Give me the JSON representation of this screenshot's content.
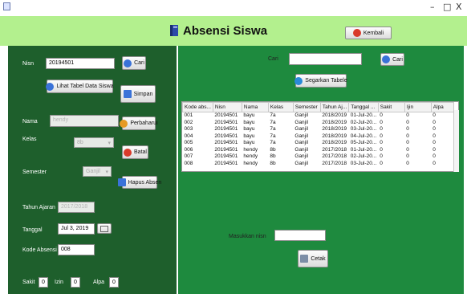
{
  "window": {
    "minimize": "–",
    "maximize": "□",
    "close": "X"
  },
  "header": {
    "title": "Absensi Siswa",
    "back_button": "Kembali"
  },
  "form": {
    "nisn_label": "Nisn",
    "nisn_value": "20194501",
    "search_button": "Cari",
    "view_table_button": "Lihat Tabel Data Siswa",
    "save_button": "Simpan",
    "nama_label": "Nama",
    "nama_value": "hendy",
    "update_button": "Perbaharui",
    "kelas_label": "Kelas",
    "kelas_value": "8b",
    "cancel_button": "Batal",
    "semester_label": "Semester",
    "semester_value": "Ganjil",
    "delete_button": "Hapus Absen",
    "tahun_label": "Tahun Ajaran",
    "tahun_value": "2017/2018",
    "tanggal_label": "Tanggal",
    "tanggal_value": "Jul 3, 2019",
    "kode_label": "Kode Absensi",
    "kode_value": "008",
    "sakit_label": "Sakit",
    "sakit_value": "0",
    "izin_label": "Izin",
    "izin_value": "0",
    "alpa_label": "Alpa",
    "alpa_value": "0"
  },
  "right": {
    "cari_label": "Cari",
    "cari_value": "",
    "cari_button": "Cari",
    "refresh_button": "Segarkan Tabele",
    "masukkan_label": "Masukkan nisn",
    "masukkan_value": "",
    "print_button": "Cetak"
  },
  "table": {
    "columns": [
      "Kode abs...",
      "Nisn",
      "Nama",
      "Kelas",
      "Semester",
      "Tahun Aj...",
      "Tanggal ...",
      "Sakit",
      "Ijin",
      "Alpa"
    ],
    "rows": [
      [
        "001",
        "20194501",
        "bayu",
        "7a",
        "Ganjil",
        "2018/2019",
        "01-Jul-20...",
        "0",
        "0",
        "0"
      ],
      [
        "002",
        "20194501",
        "bayu",
        "7a",
        "Ganjil",
        "2018/2019",
        "02-Jul-20...",
        "0",
        "0",
        "0"
      ],
      [
        "003",
        "20194501",
        "bayu",
        "7a",
        "Ganjil",
        "2018/2019",
        "03-Jul-20...",
        "0",
        "0",
        "0"
      ],
      [
        "004",
        "20194501",
        "bayu",
        "7a",
        "Ganjil",
        "2018/2019",
        "04-Jul-20...",
        "0",
        "0",
        "0"
      ],
      [
        "005",
        "20194501",
        "bayu",
        "7a",
        "Ganjil",
        "2018/2019",
        "05-Jul-20...",
        "0",
        "0",
        "0"
      ],
      [
        "006",
        "20194501",
        "hendy",
        "8b",
        "Ganjil",
        "2017/2018",
        "01-Jul-20...",
        "0",
        "0",
        "0"
      ],
      [
        "007",
        "20194501",
        "hendy",
        "8b",
        "Ganjil",
        "2017/2018",
        "02-Jul-20...",
        "0",
        "0",
        "0"
      ],
      [
        "008",
        "20194501",
        "hendy",
        "8b",
        "Ganjil",
        "2017/2018",
        "03-Jul-20...",
        "0",
        "0",
        "0"
      ]
    ]
  }
}
